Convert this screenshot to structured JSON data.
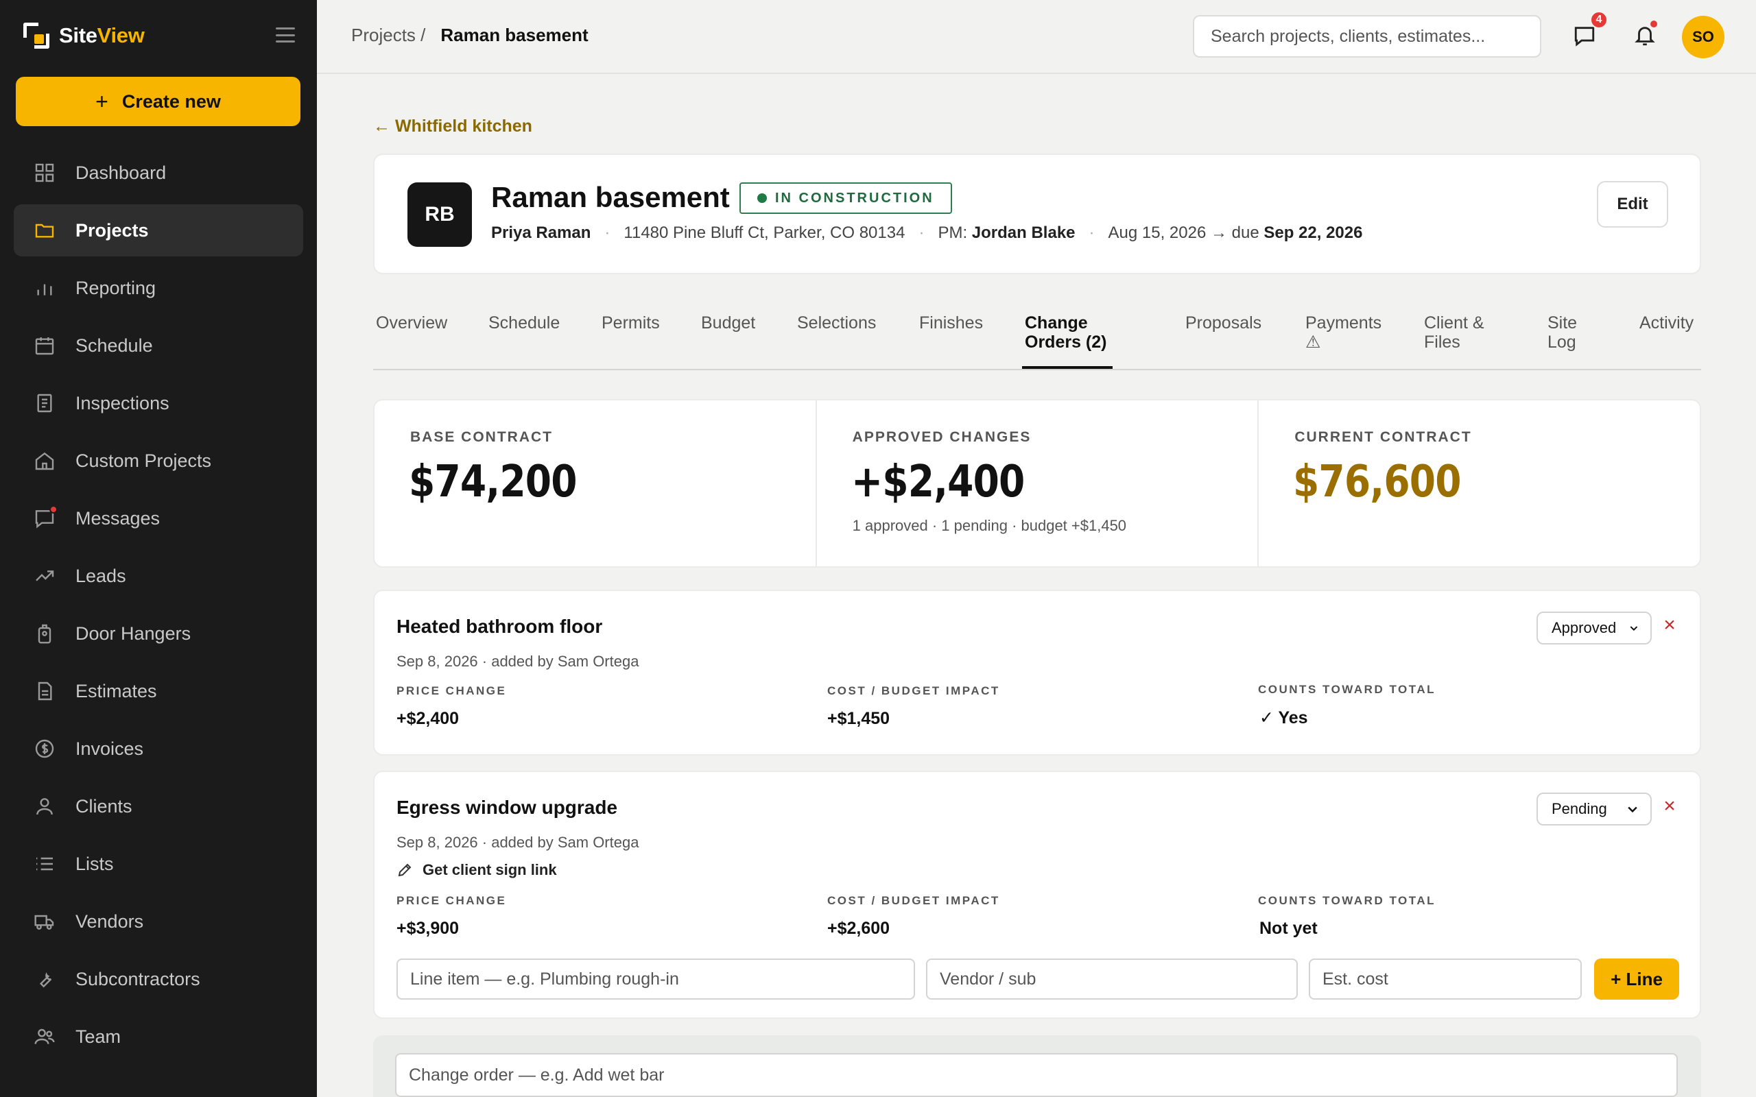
{
  "app": {
    "name_part1": "Site",
    "name_part2": "View",
    "accent": "#f7b500"
  },
  "sidebar": {
    "create_label": "Create new",
    "items": [
      {
        "label": "Dashboard",
        "icon": "grid-icon"
      },
      {
        "label": "Projects",
        "icon": "folder-icon",
        "active": true
      },
      {
        "label": "Reporting",
        "icon": "bar-chart-icon"
      },
      {
        "label": "Schedule",
        "icon": "calendar-icon"
      },
      {
        "label": "Inspections",
        "icon": "clipboard-icon"
      },
      {
        "label": "Custom Projects",
        "icon": "home-icon"
      },
      {
        "label": "Messages",
        "icon": "chat-icon"
      },
      {
        "label": "Leads",
        "icon": "trend-icon"
      },
      {
        "label": "Door Hangers",
        "icon": "tag-icon"
      },
      {
        "label": "Estimates",
        "icon": "document-icon"
      },
      {
        "label": "Invoices",
        "icon": "dollar-icon"
      },
      {
        "label": "Clients",
        "icon": "user-icon"
      },
      {
        "label": "Lists",
        "icon": "list-icon"
      },
      {
        "label": "Vendors",
        "icon": "truck-icon"
      },
      {
        "label": "Subcontractors",
        "icon": "wrench-icon"
      },
      {
        "label": "Team",
        "icon": "team-icon"
      }
    ]
  },
  "topbar": {
    "breadcrumb_root": "Projects /",
    "breadcrumb_current": "Raman basement",
    "search_placeholder": "Search projects, clients, estimates...",
    "messages_badge": "4",
    "avatar_initials": "SO"
  },
  "back_link": "← Whitfield kitchen",
  "project": {
    "initials": "RB",
    "title": "Raman basement",
    "status": "IN CONSTRUCTION",
    "client": "Priya Raman",
    "address": "11480 Pine Bluff Ct, Parker, CO 80134",
    "pm_label": "PM:",
    "pm": "Jordan Blake",
    "start": "Aug 15, 2026 → due",
    "due": "Sep 22, 2026",
    "edit_label": "Edit"
  },
  "tabs": [
    {
      "line1": "Overview",
      "line2": ""
    },
    {
      "line1": "Schedule",
      "line2": ""
    },
    {
      "line1": "Permits",
      "line2": ""
    },
    {
      "line1": "Budget",
      "line2": ""
    },
    {
      "line1": "Selections",
      "line2": ""
    },
    {
      "line1": "Finishes",
      "line2": ""
    },
    {
      "line1": "Change",
      "line2": "Orders (2)",
      "active": true
    },
    {
      "line1": "Proposals",
      "line2": ""
    },
    {
      "line1": "Payments",
      "line2": "⚠"
    },
    {
      "line1": "Client &",
      "line2": "Files"
    },
    {
      "line1": "Site",
      "line2": "Log"
    },
    {
      "line1": "Activity",
      "line2": ""
    }
  ],
  "summary": {
    "base_label": "BASE CONTRACT",
    "base_value": "$74,200",
    "approved_label": "APPROVED CHANGES",
    "approved_value": "+$2,400",
    "approved_sub": "1 approved · 1 pending · budget +$1,450",
    "current_label": "CURRENT CONTRACT",
    "current_value": "$76,600"
  },
  "labels": {
    "price_change": "PRICE CHANGE",
    "cost_impact": "COST / BUDGET IMPACT",
    "counts_toward": "COUNTS TOWARD TOTAL"
  },
  "change_orders": [
    {
      "title": "Heated bathroom floor",
      "date": "Sep 8, 2026 · added by Sam Ortega",
      "status": "Approved",
      "price": "+$2,400",
      "cost": "+$1,450",
      "counts": "✓ Yes"
    },
    {
      "title": "Egress window upgrade",
      "date": "Sep 8, 2026 · added by Sam Ortega",
      "sign_link": "Get client sign link",
      "status": "Pending",
      "price": "+$3,900",
      "cost": "+$2,600",
      "counts": "Not yet",
      "line_item_placeholder": "Line item — e.g. Plumbing rough-in",
      "vendor_placeholder": "Vendor / sub",
      "cost_placeholder": "Est. cost",
      "add_line_label": "+ Line"
    }
  ],
  "new_change_order_placeholder": "Change order — e.g. Add wet bar"
}
